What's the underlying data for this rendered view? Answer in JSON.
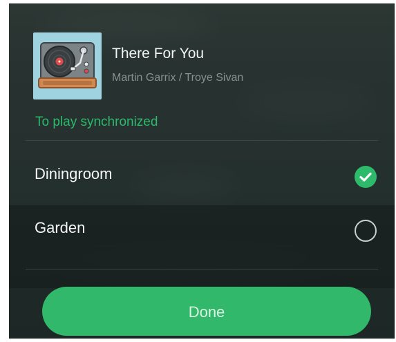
{
  "track": {
    "title": "There For You",
    "artist": "Martin Garrix / Troye Sivan",
    "album_art_icon": "turntable-icon"
  },
  "sync": {
    "label": "To play synchronized"
  },
  "rooms": [
    {
      "name": "Diningroom",
      "selected": true
    },
    {
      "name": "Garden",
      "selected": false
    }
  ],
  "actions": {
    "done_label": "Done"
  },
  "colors": {
    "accent": "#2dba6a",
    "button": "#31b86a",
    "background": "#263130",
    "album_bg": "#9ed3df"
  }
}
